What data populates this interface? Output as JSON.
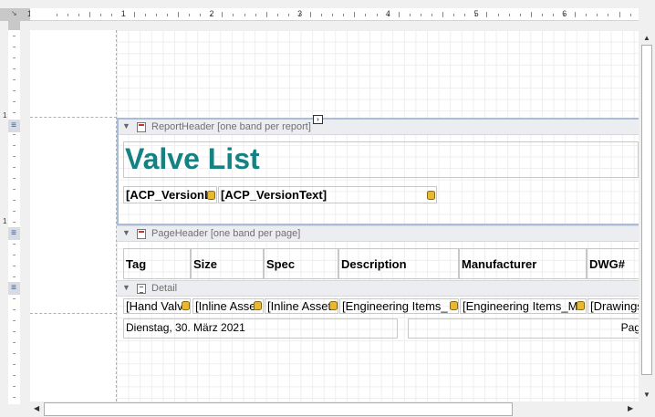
{
  "ruler": {
    "corner_icon": "ruler-corner-icon",
    "start_label": "1",
    "labels": [
      "1",
      "2",
      "3",
      "4",
      "5",
      "6"
    ],
    "vertical_labels": [
      "1",
      "1"
    ]
  },
  "bands": {
    "report_header": "ReportHeader [one band per report]",
    "page_header": "PageHeader [one band per page]",
    "detail": "Detail"
  },
  "report_header": {
    "title": "Valve List",
    "version_label": "[ACP_VersionL",
    "version_text": "[ACP_VersionText]"
  },
  "page_header": {
    "columns": [
      "Tag",
      "Size",
      "Spec",
      "Description",
      "Manufacturer",
      "DWG#"
    ]
  },
  "detail": {
    "fields": [
      "[Hand Valv",
      "[Inline Asse",
      "[Inline Asset",
      "[Engineering Items_",
      "[Engineering Items_M",
      "[Drawings"
    ]
  },
  "footer": {
    "date": "Dienstag, 30. März 2021",
    "page": "Pag"
  },
  "colors": {
    "title": "#148282",
    "selection": "#a9bcd8",
    "band_strip": "#ecedf1"
  }
}
